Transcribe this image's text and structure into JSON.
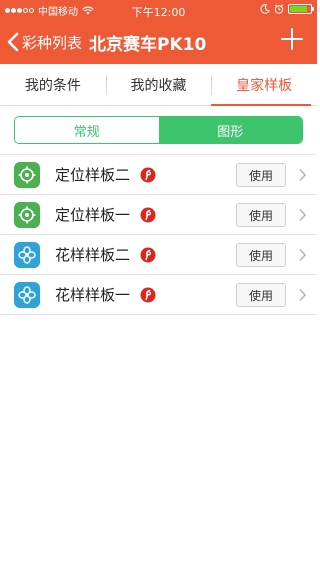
{
  "status_bar": {
    "carrier": "中国移动",
    "time": "下午12:00",
    "battery_level": 0.85,
    "signal_bars_filled": 3,
    "signal_bars_total": 5
  },
  "nav": {
    "back_label": "彩种列表",
    "title": "北京赛车PK10",
    "plus_icon": "plus-icon"
  },
  "tabs": [
    {
      "label": "我的条件",
      "active": false
    },
    {
      "label": "我的收藏",
      "active": false
    },
    {
      "label": "皇家样板",
      "active": true
    }
  ],
  "segment": [
    {
      "label": "常规",
      "active": false
    },
    {
      "label": "图形",
      "active": true
    }
  ],
  "items": [
    {
      "label": "定位样板二",
      "icon": "target-icon",
      "icon_color": "#4caf50",
      "button": "使用"
    },
    {
      "label": "定位样板一",
      "icon": "target-icon",
      "icon_color": "#4caf50",
      "button": "使用"
    },
    {
      "label": "花样样板二",
      "icon": "flower-icon",
      "icon_color": "#2fa3d6",
      "button": "使用"
    },
    {
      "label": "花样样板一",
      "icon": "flower-icon",
      "icon_color": "#2fa3d6",
      "button": "使用"
    }
  ],
  "colors": {
    "accent": "#ee5a36",
    "green": "#3ec46d",
    "badge": "#e0231b"
  }
}
